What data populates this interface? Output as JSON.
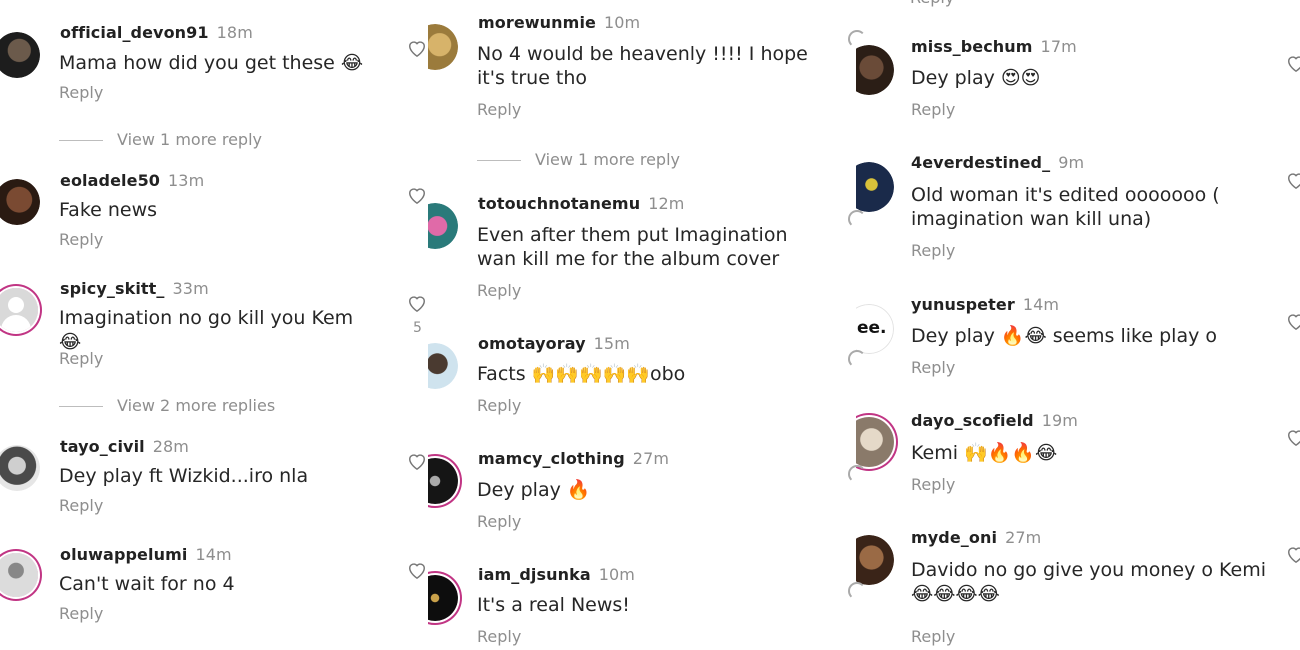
{
  "columns": [
    {
      "comments": [
        {
          "user": "official_devon91",
          "time": "18m",
          "text": "Mama how did you get these 😂",
          "reply": "Reply",
          "more": "View 1 more reply"
        },
        {
          "user": "eoladele50",
          "time": "13m",
          "text": "Fake news",
          "reply": "Reply"
        },
        {
          "user": "spicy_skitt_",
          "time": "33m",
          "text": "Imagination no go kill you Kem 😂",
          "reply": "Reply",
          "more": "View 2 more replies"
        },
        {
          "user": "tayo_civil",
          "time": "28m",
          "text": "Dey play ft Wizkid...iro nla",
          "reply": "Reply"
        },
        {
          "user": "oluwappelumi",
          "time": "14m",
          "text": "Can't wait for no 4",
          "reply": "Reply"
        }
      ]
    },
    {
      "comments": [
        {
          "user": "morewunmie",
          "time": "10m",
          "text": "No 4 would be heavenly !!!! I hope it's true tho",
          "reply": "Reply",
          "more": "View 1 more reply"
        },
        {
          "user": "totouchnotanemu",
          "time": "12m",
          "text": "Even after them put Imagination wan kill me for the album cover",
          "reply": "Reply",
          "likes": "5"
        },
        {
          "user": "omotayoray",
          "time": "15m",
          "text": "Facts 🙌🙌🙌🙌🙌obo",
          "reply": "Reply"
        },
        {
          "user": "mamcy_clothing",
          "time": "27m",
          "text": "Dey play 🔥",
          "reply": "Reply"
        },
        {
          "user": "iam_djsunka",
          "time": "10m",
          "text": "It's a real News!",
          "reply": "Reply"
        }
      ]
    },
    {
      "comments": [
        {
          "user": "miss_bechum",
          "time": "17m",
          "text": "Dey play 😍😍",
          "reply": "Reply"
        },
        {
          "user": "4everdestined_",
          "time": "9m",
          "text": "Old woman it's edited ooooooo ( imagination wan kill una)",
          "reply": "Reply"
        },
        {
          "user": "yunuspeter",
          "time": "14m",
          "text": "Dey play 🔥😂 seems like play o",
          "reply": "Reply",
          "avatar_text": "ee."
        },
        {
          "user": "dayo_scofield",
          "time": "19m",
          "text": "Kemi 🙌🔥🔥😂",
          "reply": "Reply"
        },
        {
          "user": "myde_oni",
          "time": "27m",
          "text": "Davido no go give you money o Kemi 😂😂😂😂",
          "reply": "Reply"
        }
      ]
    }
  ],
  "icons": {
    "like": "heart-outline-icon",
    "loading": "spinner-arc-icon"
  },
  "colors": {
    "text": "#262626",
    "muted": "#8e8e8e",
    "story_ring": "#c13584"
  }
}
